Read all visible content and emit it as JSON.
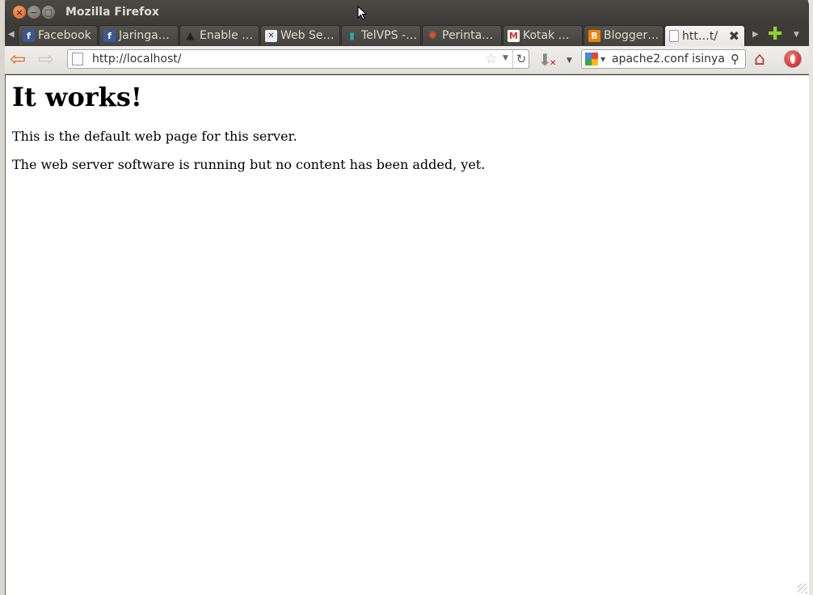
{
  "window": {
    "title": "Mozilla Firefox"
  },
  "tabs": [
    {
      "label": "Facebook",
      "icon": "facebook-icon",
      "active": false
    },
    {
      "label": "Jaringa…",
      "icon": "facebook-icon",
      "active": false
    },
    {
      "label": "Enable …",
      "icon": "tux-icon",
      "active": false
    },
    {
      "label": "Web Se…",
      "icon": "web-icon",
      "active": false
    },
    {
      "label": "TelVPS -…",
      "icon": "telvps-icon",
      "active": false
    },
    {
      "label": "Perinta…",
      "icon": "ubuntu-icon",
      "active": false
    },
    {
      "label": "Kotak …",
      "icon": "gmail-icon",
      "active": false
    },
    {
      "label": "Blogger…",
      "icon": "blogger-icon",
      "active": false
    },
    {
      "label": "htt…t/",
      "icon": "page-icon",
      "active": true
    }
  ],
  "navbar": {
    "url": "http://localhost/",
    "search_query": "apache2.conf isinya",
    "search_engine": "google-icon"
  },
  "page": {
    "heading": "It works!",
    "paragraph1": "This is the default web page for this server.",
    "paragraph2": "The web server software is running but no content has been added, yet."
  },
  "colors": {
    "titlebar": "#3c3b37",
    "close_button": "#e2561c",
    "back_arrow": "#e06b1e",
    "new_tab_plus": "#8ed137"
  }
}
